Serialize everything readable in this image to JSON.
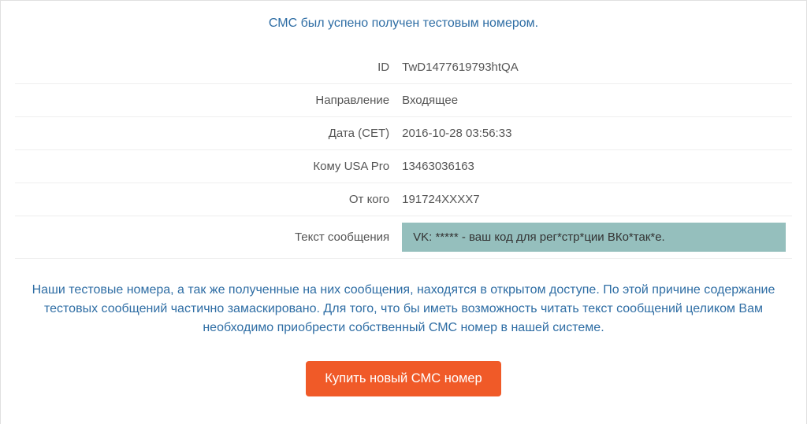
{
  "status_message": "СМС был успено получен тестовым номером.",
  "details": {
    "id_label": "ID",
    "id_value": "TwD1477619793htQA",
    "direction_label": "Направление",
    "direction_value": "Входящее",
    "date_label": "Дата (CET)",
    "date_value": "2016-10-28 03:56:33",
    "to_label": "Кому USA Pro",
    "to_value": "13463036163",
    "from_label": "От кого",
    "from_value": "191724XXXX7",
    "msgtext_label": "Текст сообщения",
    "msgtext_value": "VK: ***** - ваш код для рег*стр*ции ВКо*так*е."
  },
  "info_paragraph": "Наши тестовые номера, а так же полученные на них сообщения, находятся в открытом доступе. По этой причине содержание тестовых сообщений частично замаскировано. Для того, что бы иметь возможность читать текст сообщений целиком Вам необходимо приобрести собственный СМС номер в нашей системе.",
  "buy_button_label": "Купить новый СМС номер"
}
